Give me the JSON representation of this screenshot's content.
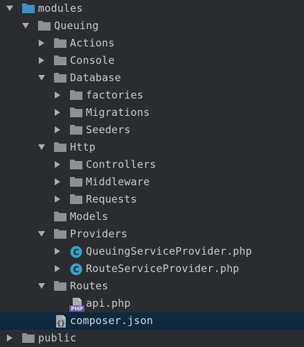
{
  "colors": {
    "background": "#2b2c2f",
    "selection": "#0d293e",
    "text": "#c9cbd0",
    "folder": "#8d9196",
    "module_folder": "#3f8fc4",
    "class_icon": "#3aa0cc"
  },
  "tree": [
    {
      "name": "modules",
      "icon": "module-folder-icon",
      "expanded": true
    },
    {
      "name": "Queuing",
      "icon": "folder-icon",
      "expanded": true
    },
    {
      "name": "Actions",
      "icon": "folder-icon",
      "expanded": false
    },
    {
      "name": "Console",
      "icon": "folder-icon",
      "expanded": false
    },
    {
      "name": "Database",
      "icon": "folder-icon",
      "expanded": true
    },
    {
      "name": "factories",
      "icon": "folder-icon",
      "expanded": false
    },
    {
      "name": "Migrations",
      "icon": "folder-icon",
      "expanded": false
    },
    {
      "name": "Seeders",
      "icon": "folder-icon",
      "expanded": false
    },
    {
      "name": "Http",
      "icon": "folder-icon",
      "expanded": true
    },
    {
      "name": "Controllers",
      "icon": "folder-icon",
      "expanded": false
    },
    {
      "name": "Middleware",
      "icon": "folder-icon",
      "expanded": false
    },
    {
      "name": "Requests",
      "icon": "folder-icon",
      "expanded": false
    },
    {
      "name": "Models",
      "icon": "folder-icon",
      "expanded": null
    },
    {
      "name": "Providers",
      "icon": "folder-icon",
      "expanded": true
    },
    {
      "name": "QueuingServiceProvider.php",
      "icon": "php-class-icon",
      "expanded": false
    },
    {
      "name": "RouteServiceProvider.php",
      "icon": "php-class-icon",
      "expanded": false
    },
    {
      "name": "Routes",
      "icon": "folder-icon",
      "expanded": true
    },
    {
      "name": "api.php",
      "icon": "php-file-icon",
      "expanded": null
    },
    {
      "name": "composer.json",
      "icon": "json-file-icon",
      "expanded": null,
      "selected": true
    },
    {
      "name": "public",
      "icon": "folder-icon",
      "expanded": false
    }
  ]
}
